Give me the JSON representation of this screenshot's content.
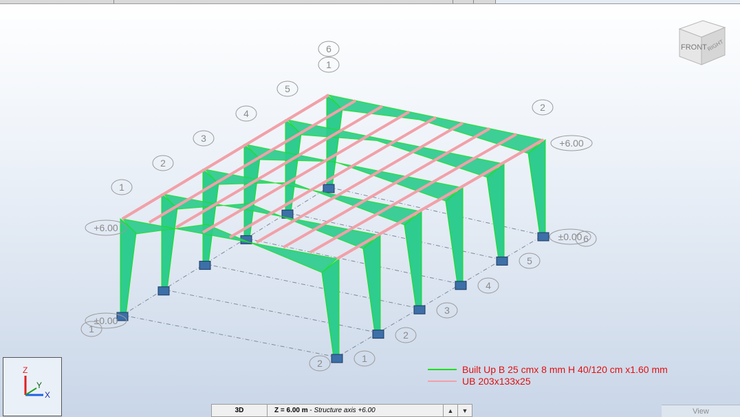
{
  "viewport": {
    "axis_numbers_left": [
      "1",
      "2",
      "3",
      "4",
      "5",
      "6"
    ],
    "axis_numbers_right": [
      "1",
      "2",
      "3",
      "4",
      "5",
      "6"
    ],
    "axis_numbers_across": [
      "1",
      "2"
    ],
    "level_top": "+6.00",
    "level_bottom": "±0.00"
  },
  "viewcube": {
    "front": "FRONT",
    "right": "RIGHT"
  },
  "axes_gizmo": {
    "z": "Z",
    "y": "Y",
    "x": "X"
  },
  "legend": [
    {
      "label": "Built  Up B 25 cmx 8 mm H 40/120 cm x1.60 mm",
      "color": "#19e01c"
    },
    {
      "label": "UB 203x133x25",
      "color": "#f2a0a8"
    }
  ],
  "statusbar": {
    "mode": "3D",
    "plane_value": "Z = 6.00 m",
    "plane_desc": "Structure axis +6.00"
  },
  "view_button": "View",
  "colors": {
    "frame": "#2ecc8e",
    "frame_edge": "#19e01c",
    "purlin": "#f2a0a8",
    "base": "#3d6fa8"
  }
}
